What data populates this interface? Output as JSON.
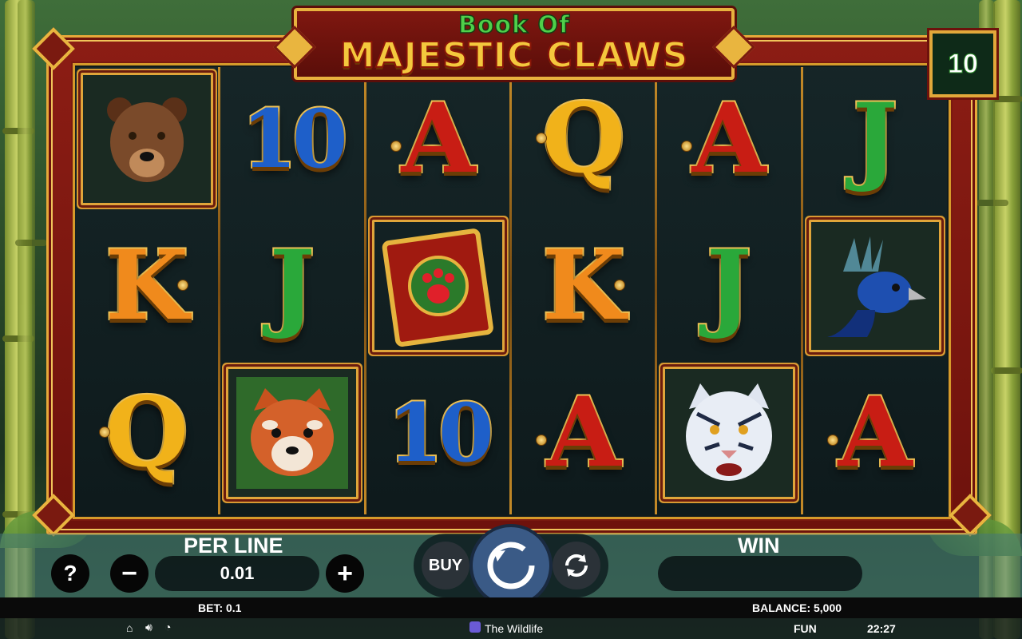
{
  "game": {
    "title_top": "Book Of",
    "title_main": "Majestic Claws",
    "lines": "10"
  },
  "reels": [
    [
      {
        "type": "card",
        "name": "bear-symbol",
        "icon": "bear",
        "color": "#7a4a2a"
      },
      {
        "type": "letter",
        "name": "k-symbol",
        "text": "K",
        "color": "#f08a1c"
      },
      {
        "type": "letter",
        "name": "q-symbol",
        "text": "Q",
        "color": "#f1b21a"
      }
    ],
    [
      {
        "type": "letter",
        "name": "ten-symbol",
        "text": "10",
        "color": "#1e5fc9"
      },
      {
        "type": "letter",
        "name": "j-symbol",
        "text": "J",
        "color": "#2aa83a"
      },
      {
        "type": "card",
        "name": "red-panda-symbol",
        "icon": "red-panda",
        "color": "#c8521e"
      }
    ],
    [
      {
        "type": "letter",
        "name": "a-symbol",
        "text": "A",
        "color": "#c81d14"
      },
      {
        "type": "card",
        "name": "book-symbol",
        "icon": "book",
        "color": "#b31f14"
      },
      {
        "type": "letter",
        "name": "ten-symbol",
        "text": "10",
        "color": "#1e5fc9"
      }
    ],
    [
      {
        "type": "letter",
        "name": "q-symbol",
        "text": "Q",
        "color": "#f1b21a"
      },
      {
        "type": "letter",
        "name": "k-symbol",
        "text": "K",
        "color": "#f08a1c"
      },
      {
        "type": "letter",
        "name": "a-symbol",
        "text": "A",
        "color": "#c81d14"
      }
    ],
    [
      {
        "type": "letter",
        "name": "a-symbol",
        "text": "A",
        "color": "#c81d14"
      },
      {
        "type": "letter",
        "name": "j-symbol",
        "text": "J",
        "color": "#2aa83a"
      },
      {
        "type": "card",
        "name": "tiger-symbol",
        "icon": "tiger",
        "color": "#cfd7e6"
      }
    ],
    [
      {
        "type": "letter",
        "name": "j-symbol",
        "text": "J",
        "color": "#2aa83a"
      },
      {
        "type": "card",
        "name": "peacock-symbol",
        "icon": "peacock",
        "color": "#1e4fb0"
      },
      {
        "type": "letter",
        "name": "a-symbol",
        "text": "A",
        "color": "#c81d14"
      }
    ]
  ],
  "controls": {
    "help": "?",
    "per_line_label": "PER LINE",
    "per_line_value": "0.01",
    "minus": "−",
    "plus": "+",
    "buy": "BUY",
    "win_label": "WIN",
    "win_value": ""
  },
  "status": {
    "bet": "BET: 0.1",
    "balance": "BALANCE: 5,000",
    "mode": "FUN",
    "time": "22:27"
  },
  "footer": {
    "game_name": "The Wildlife"
  }
}
